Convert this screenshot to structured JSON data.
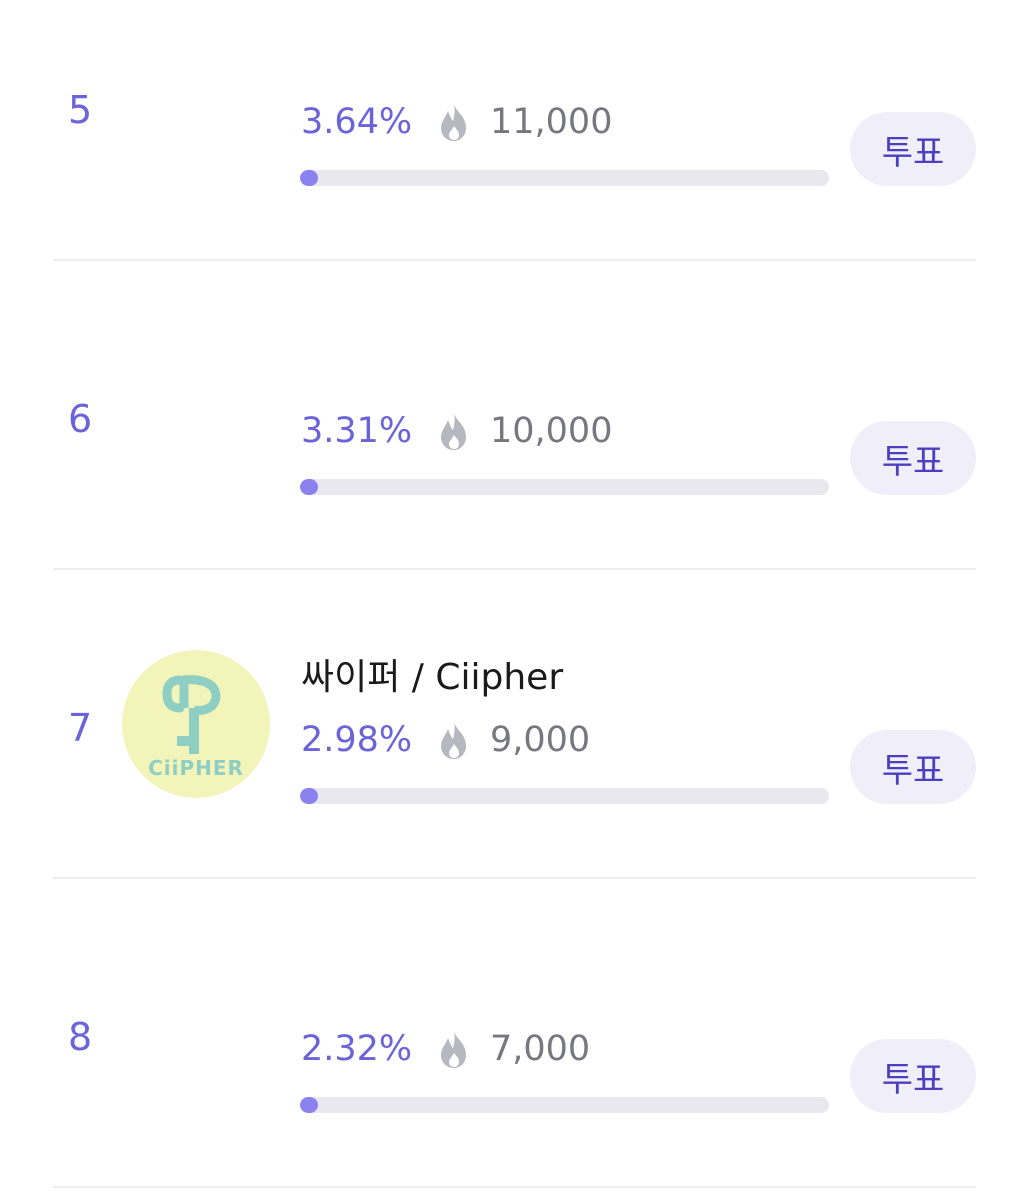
{
  "rows": [
    {
      "rank": "5",
      "name": "",
      "percent": "3.64%",
      "percent_value": 3.64,
      "count": "11,000",
      "vote_label": "투표",
      "has_avatar": false
    },
    {
      "rank": "6",
      "name": "",
      "percent": "3.31%",
      "percent_value": 3.31,
      "count": "10,000",
      "vote_label": "투표",
      "has_avatar": false
    },
    {
      "rank": "7",
      "name": "싸이퍼 / Ciipher",
      "percent": "2.98%",
      "percent_value": 2.98,
      "count": "9,000",
      "vote_label": "투표",
      "has_avatar": true,
      "avatar_text": "CiiPHER"
    },
    {
      "rank": "8",
      "name": "",
      "percent": "2.32%",
      "percent_value": 2.32,
      "count": "7,000",
      "vote_label": "투표",
      "has_avatar": false
    }
  ],
  "colors": {
    "accent": "#6b63d8",
    "bar_fill": "#8b82ef",
    "bar_track": "#e8e8ee",
    "vote_bg": "#efeef9",
    "vote_text": "#4b3fc0",
    "count_text": "#77777f",
    "avatar_bg": "#f3f4ba",
    "avatar_mark": "#8fcfc3"
  },
  "icons": {
    "count_icon": "fire-icon"
  }
}
